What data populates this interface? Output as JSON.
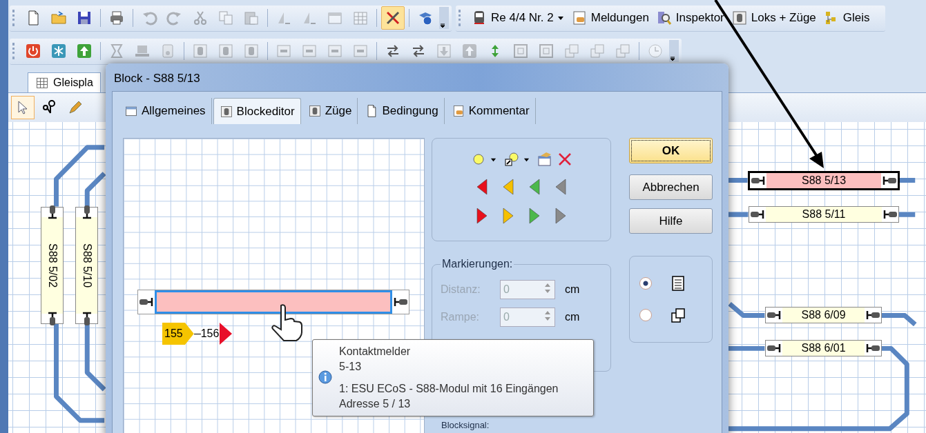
{
  "toolbar_1": {
    "items": [
      {
        "kind": "button",
        "disabled": false,
        "selected": false
      },
      {
        "kind": "button",
        "disabled": false,
        "selected": false
      },
      {
        "kind": "button",
        "disabled": false,
        "selected": false
      },
      {
        "kind": "separator"
      },
      {
        "kind": "button",
        "disabled": false,
        "selected": false
      },
      {
        "kind": "separator"
      },
      {
        "kind": "button",
        "disabled": true,
        "selected": false
      },
      {
        "kind": "button",
        "disabled": true,
        "selected": false
      },
      {
        "kind": "button",
        "disabled": true,
        "selected": false
      },
      {
        "kind": "button",
        "disabled": true,
        "selected": false
      },
      {
        "kind": "button",
        "disabled": true,
        "selected": false
      },
      {
        "kind": "separator"
      },
      {
        "kind": "button",
        "disabled": true,
        "selected": false
      },
      {
        "kind": "button",
        "disabled": true,
        "selected": false
      },
      {
        "kind": "button",
        "disabled": true,
        "selected": false
      },
      {
        "kind": "button",
        "disabled": true,
        "selected": false
      },
      {
        "kind": "separator"
      },
      {
        "kind": "button",
        "disabled": false,
        "selected": true
      },
      {
        "kind": "separator"
      },
      {
        "kind": "button",
        "disabled": false,
        "selected": false
      }
    ]
  },
  "quick_links": [
    {
      "label": "Re 4/4 Nr. 2",
      "dropdown": true
    },
    {
      "label": "Meldungen",
      "dropdown": false
    },
    {
      "label": "Inspektor",
      "dropdown": false
    },
    {
      "label": "Loks + Züge",
      "dropdown": false
    },
    {
      "label": "Gleis",
      "dropdown": false
    }
  ],
  "toolbar_2": {
    "items": [
      {
        "kind": "button",
        "disabled": false,
        "selected": false
      },
      {
        "kind": "button",
        "disabled": false,
        "selected": false
      },
      {
        "kind": "button",
        "disabled": false,
        "selected": false
      },
      {
        "kind": "separator"
      },
      {
        "kind": "button",
        "disabled": true,
        "selected": false
      },
      {
        "kind": "button",
        "disabled": true,
        "selected": false
      },
      {
        "kind": "button",
        "disabled": true,
        "selected": false
      },
      {
        "kind": "separator"
      },
      {
        "kind": "button",
        "disabled": true,
        "selected": false
      },
      {
        "kind": "button",
        "disabled": true,
        "selected": false
      },
      {
        "kind": "button",
        "disabled": true,
        "selected": false
      },
      {
        "kind": "separator"
      },
      {
        "kind": "button",
        "disabled": true,
        "selected": false
      },
      {
        "kind": "button",
        "disabled": true,
        "selected": false
      },
      {
        "kind": "button",
        "disabled": true,
        "selected": false
      },
      {
        "kind": "button",
        "disabled": true,
        "selected": false
      },
      {
        "kind": "separator"
      },
      {
        "kind": "button",
        "disabled": false,
        "selected": false
      },
      {
        "kind": "button",
        "disabled": false,
        "selected": false
      },
      {
        "kind": "button",
        "disabled": true,
        "selected": false
      },
      {
        "kind": "button",
        "disabled": true,
        "selected": false
      },
      {
        "kind": "button",
        "disabled": false,
        "selected": false
      },
      {
        "kind": "button",
        "disabled": true,
        "selected": false
      },
      {
        "kind": "button",
        "disabled": true,
        "selected": false
      },
      {
        "kind": "button",
        "disabled": true,
        "selected": false
      },
      {
        "kind": "button",
        "disabled": true,
        "selected": false
      },
      {
        "kind": "button",
        "disabled": true,
        "selected": false
      },
      {
        "kind": "separator"
      },
      {
        "kind": "button",
        "disabled": true,
        "selected": false
      }
    ]
  },
  "document_tab": {
    "label": "Gleispla",
    "selected": true
  },
  "canvas_tools": [
    {
      "selected": true
    },
    {
      "selected": false
    },
    {
      "selected": false
    }
  ],
  "track_blocks": [
    {
      "label": "S88 5/02",
      "kind": "vertical",
      "selected": false
    },
    {
      "label": "S88 5/10",
      "kind": "vertical",
      "selected": false
    },
    {
      "label": "S88 5/13",
      "kind": "horizontal",
      "selected": true
    },
    {
      "label": "S88 5/11",
      "kind": "horizontal",
      "selected": false
    },
    {
      "label": "S88 6/09",
      "kind": "horizontal",
      "selected": false
    },
    {
      "label": "S88 6/01",
      "kind": "horizontal",
      "selected": false
    }
  ],
  "dialog": {
    "title": "Block - S88 5/13",
    "tabs": [
      {
        "label": "Allgemeines",
        "selected": false
      },
      {
        "label": "Blockeditor",
        "selected": true
      },
      {
        "label": "Züge",
        "selected": false
      },
      {
        "label": "Bedingung",
        "selected": false
      },
      {
        "label": "Kommentar",
        "selected": false
      }
    ],
    "editor": {
      "block": {
        "selected": true
      },
      "markers": [
        {
          "kind": "tag",
          "label": "155",
          "color": "#f5c400"
        },
        {
          "kind": "signal",
          "label": "156",
          "color": "#e8102a"
        }
      ]
    },
    "signals": [
      {
        "kind": "left",
        "color": "#e8101c"
      },
      {
        "kind": "left",
        "color": "#f5c000"
      },
      {
        "kind": "left",
        "color": "#4cb84c"
      },
      {
        "kind": "left",
        "color": "#8a8a8a"
      },
      {
        "kind": "right",
        "color": "#e8101c"
      },
      {
        "kind": "right",
        "color": "#f5c000"
      },
      {
        "kind": "right",
        "color": "#4cb84c"
      },
      {
        "kind": "right",
        "color": "#8a8a8a"
      }
    ],
    "markings": {
      "title": "Markierungen:",
      "fields": [
        {
          "label": "Distanz:",
          "value": "0",
          "unit": "cm",
          "disabled": true
        },
        {
          "label": "Rampe:",
          "value": "0",
          "unit": "cm",
          "disabled": true
        }
      ]
    },
    "block_signal": {
      "title": "Blocksignal:"
    },
    "buttons": [
      {
        "label": "OK",
        "default": true
      },
      {
        "label": "Abbrechen",
        "default": false
      },
      {
        "label": "Hilfe",
        "default": false
      }
    ],
    "view_options": [
      {
        "selected": true
      },
      {
        "selected": false
      }
    ]
  },
  "tooltip": {
    "title_lines": [
      "Kontaktmelder",
      "5-13"
    ],
    "detail_lines": [
      "1: ESU ECoS - S88-Modul mit 16 Eingängen",
      "Adresse 5 / 13"
    ]
  }
}
